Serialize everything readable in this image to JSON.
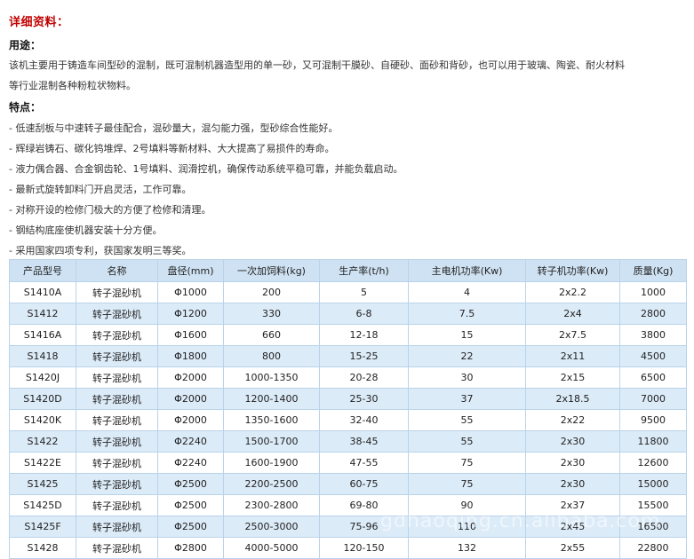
{
  "title": "详细资料：",
  "usage": {
    "heading": "用途：",
    "lines": [
      "该机主要用于铸造车间型砂的混制，既可混制机器造型用的单一砂，又可混制干膜砂、自硬砂、面砂和背砂，也可以用于玻璃、陶瓷、耐火材料",
      "等行业混制各种粉粒状物料。"
    ]
  },
  "features": {
    "heading": "特点：",
    "items": [
      "- 低速刮板与中速转子最佳配合，混砂量大，混匀能力强，型砂综合性能好。",
      "- 辉绿岩铸石、碳化钨堆焊、2号填料等新材料、大大提高了易损件的寿命。",
      "- 液力偶合器、合金钢齿轮、1号填料、润滑控机，确保传动系统平稳可靠，并能负载启动。",
      "- 最新式旋转卸料门开启灵活，工作可靠。",
      "- 对称开设的检修门极大的方便了检修和清理。",
      "- 钢结构底座使机器安装十分方便。",
      "- 采用国家四项专利，获国家发明三等奖。"
    ]
  },
  "table": {
    "headers": [
      "产品型号",
      "名称",
      "盘径(mm)",
      "一次加饲料(kg)",
      "生产率(t/h)",
      "主电机功率(Kw)",
      "转子机功率(Kw)",
      "质量(Kg)"
    ],
    "rows": [
      [
        "S1410A",
        "转子混砂机",
        "Φ1000",
        "200",
        "5",
        "4",
        "2x2.2",
        "1000"
      ],
      [
        "S1412",
        "转子混砂机",
        "Φ1200",
        "330",
        "6-8",
        "7.5",
        "2x4",
        "2800"
      ],
      [
        "S1416A",
        "转子混砂机",
        "Φ1600",
        "660",
        "12-18",
        "15",
        "2x7.5",
        "3800"
      ],
      [
        "S1418",
        "转子混砂机",
        "Φ1800",
        "800",
        "15-25",
        "22",
        "2x11",
        "4500"
      ],
      [
        "S1420J",
        "转子混砂机",
        "Φ2000",
        "1000-1350",
        "20-28",
        "30",
        "2x15",
        "6500"
      ],
      [
        "S1420D",
        "转子混砂机",
        "Φ2000",
        "1200-1400",
        "25-30",
        "37",
        "2x18.5",
        "7000"
      ],
      [
        "S1420K",
        "转子混砂机",
        "Φ2000",
        "1350-1600",
        "32-40",
        "55",
        "2x22",
        "9500"
      ],
      [
        "S1422",
        "转子混砂机",
        "Φ2240",
        "1500-1700",
        "38-45",
        "55",
        "2x30",
        "11800"
      ],
      [
        "S1422E",
        "转子混砂机",
        "Φ2240",
        "1600-1900",
        "47-55",
        "75",
        "2x30",
        "12600"
      ],
      [
        "S1425",
        "转子混砂机",
        "Φ2500",
        "2200-2500",
        "60-75",
        "75",
        "2x30",
        "15000"
      ],
      [
        "S1425D",
        "转子混砂机",
        "Φ2500",
        "2300-2800",
        "69-80",
        "90",
        "2x37",
        "15500"
      ],
      [
        "S1425F",
        "转子混砂机",
        "Φ2500",
        "2500-3000",
        "75-96",
        "110",
        "2x45",
        "16500"
      ],
      [
        "S1428",
        "转子混砂机",
        "Φ2800",
        "4000-5000",
        "120-150",
        "132",
        "2x55",
        "22800"
      ]
    ]
  },
  "watermark": "gdhaoqing.cn.alibaba.com",
  "colors": {
    "title": "#c00000",
    "header_bg": "#cfe2f3",
    "row_alt_bg": "#dcebf8",
    "border": "#b9d3ea"
  }
}
